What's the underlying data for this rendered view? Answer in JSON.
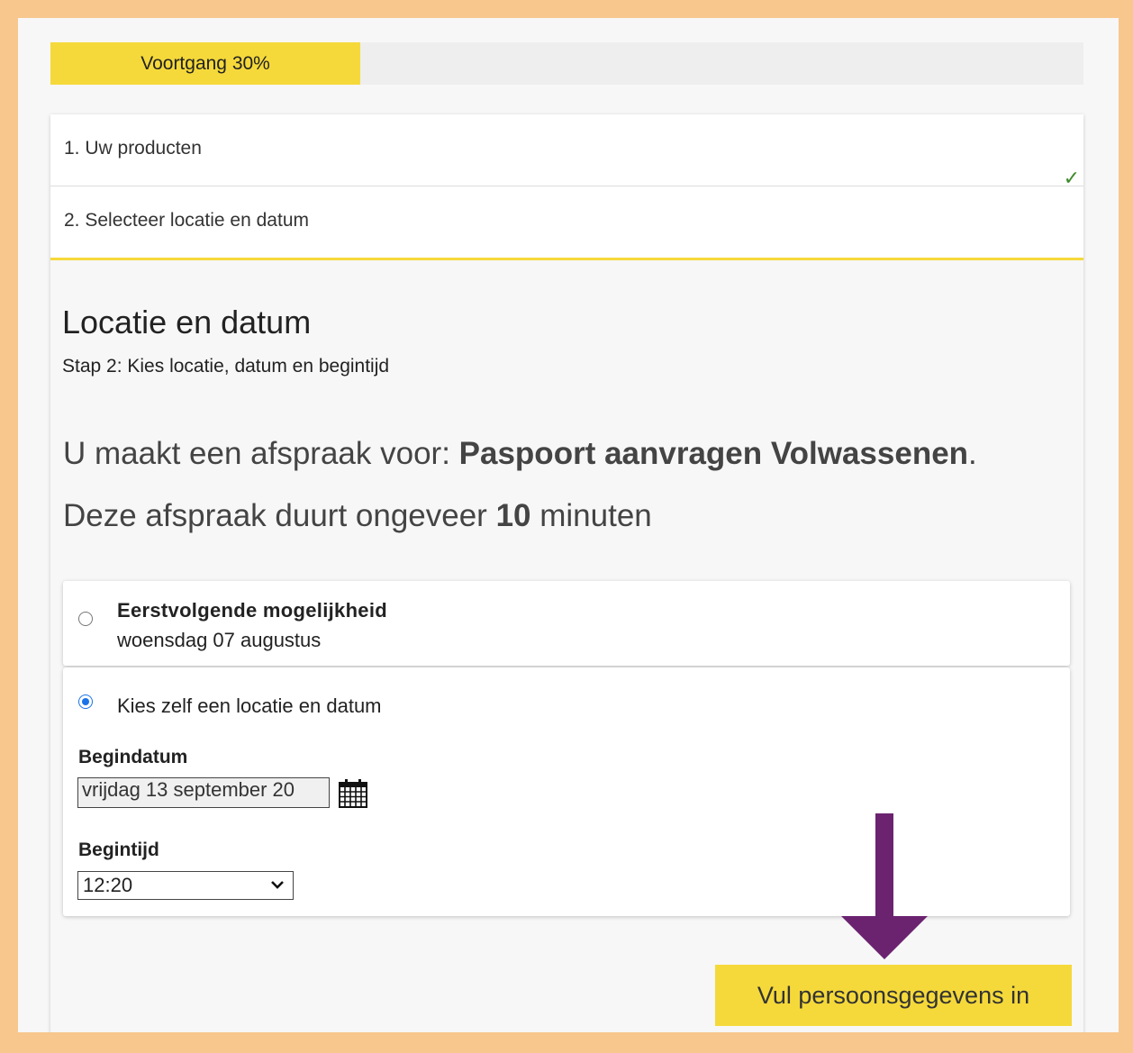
{
  "progress": {
    "label": "Voortgang 30%",
    "value": 0.3,
    "color": "#f5d93a"
  },
  "steps": [
    {
      "label": "1. Uw producten",
      "completed": true,
      "icon": "checkmark-icon"
    },
    {
      "label": "2. Selecteer locatie en datum",
      "active": true
    }
  ],
  "heading": {
    "title": "Locatie en datum",
    "subtitle": "Stap 2: Kies locatie, datum en begintijd"
  },
  "appointment": {
    "prefix": "U maakt een afspraak voor: ",
    "product": "Paspoort aanvragen Volwassenen",
    "suffix": ".",
    "duration_prefix": "Deze afspraak duurt ongeveer ",
    "duration_value": "10",
    "duration_suffix": " minuten"
  },
  "options": {
    "first": {
      "title": "Eerstvolgende mogelijkheid",
      "date": "woensdag 07 augustus",
      "selected": false
    },
    "custom": {
      "label": "Kies zelf een locatie en datum",
      "selected": true
    }
  },
  "form": {
    "start_date_label": "Begindatum",
    "start_date_value": "vrijdag 13 september 20",
    "start_time_label": "Begintijd",
    "start_time_value": "12:20",
    "calendar_icon": "calendar-icon"
  },
  "annotation": {
    "icon": "down-arrow-icon",
    "color": "#6b2370"
  },
  "next_button": {
    "label": "Vul persoonsgegevens in"
  }
}
